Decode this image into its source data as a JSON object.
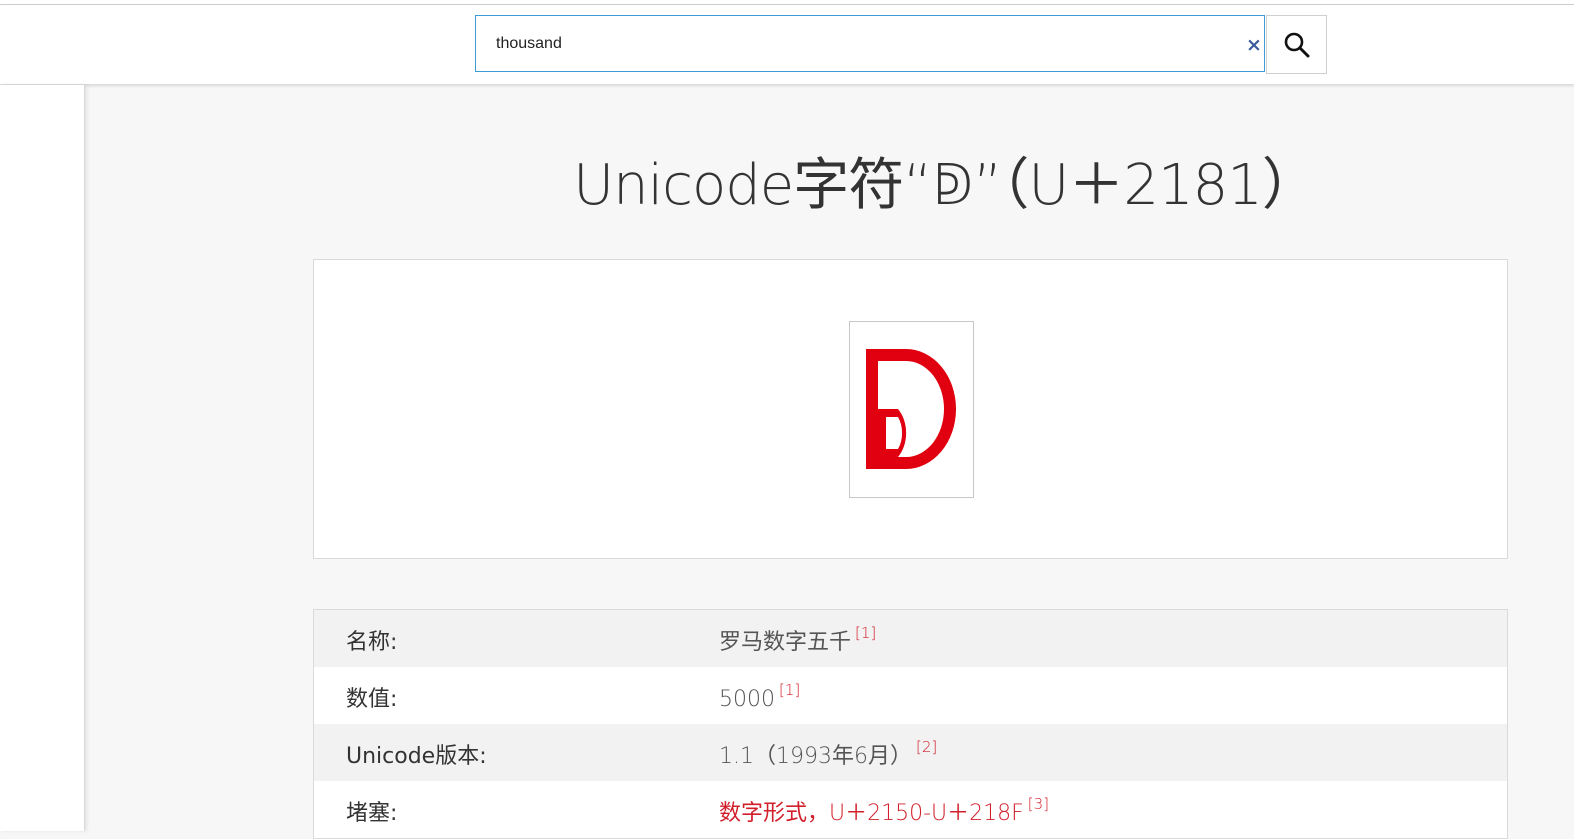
{
  "search": {
    "value": "thousand",
    "clear_glyph": "×",
    "search_icon": "magnifier-icon"
  },
  "page": {
    "title": "Unicode字符“ↁ”（U＋2181）"
  },
  "figure": {
    "glyph": "ↁ",
    "glyph_color": "#e0000f"
  },
  "info": {
    "rows": [
      {
        "key": "名称:",
        "value": "罗马数字五千",
        "ref": "[1]",
        "link": false
      },
      {
        "key": "数值:",
        "value": "5000",
        "ref": "[1]",
        "link": false
      },
      {
        "key": "Unicode版本:",
        "value": "1.1（1993年6月）",
        "ref": "[2]",
        "link": false
      },
      {
        "key": "堵塞:",
        "value": "数字形式，U＋2150-U＋218F",
        "ref": "[3]",
        "link": true
      }
    ]
  },
  "colors": {
    "accent_link": "#d1202b",
    "search_border": "#3d9bd6"
  }
}
